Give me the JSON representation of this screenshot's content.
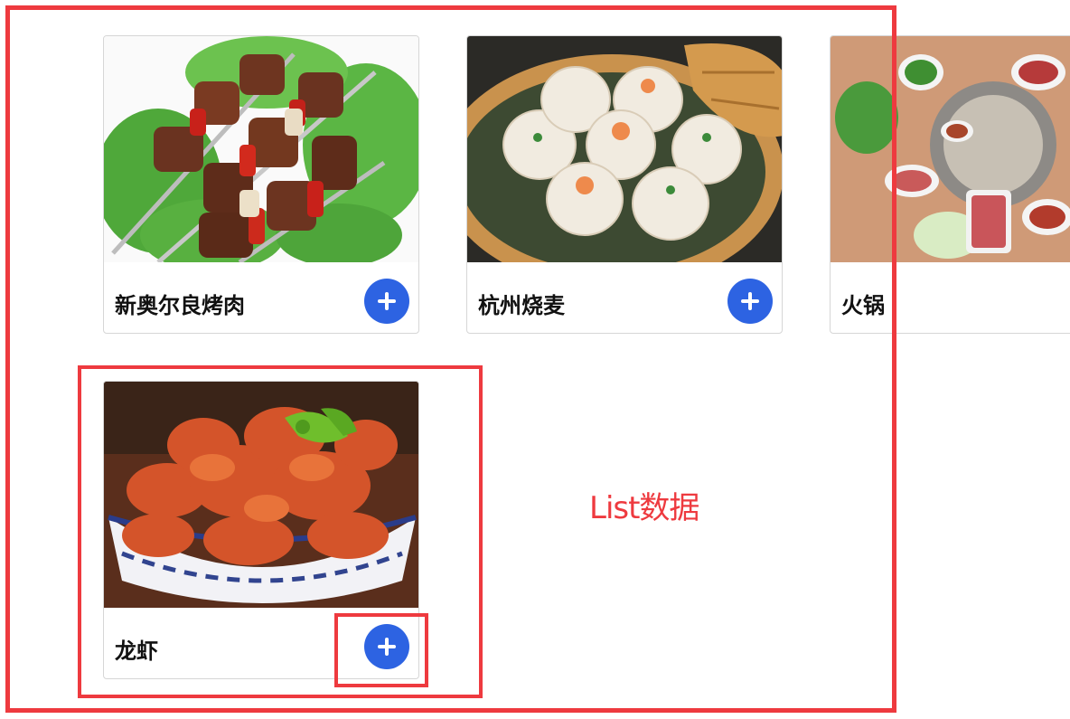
{
  "annotation": {
    "label": "List数据",
    "color": "#ee3a3f"
  },
  "items": [
    {
      "name": "新奥尔良烤肉",
      "add_button": "add-icon"
    },
    {
      "name": "杭州烧麦",
      "add_button": "add-icon"
    },
    {
      "name": "火锅",
      "add_button": "add-icon"
    },
    {
      "name": "龙虾",
      "add_button": "add-icon"
    }
  ],
  "colors": {
    "accent": "#2d63e2",
    "card_border": "#d6d6d6"
  }
}
